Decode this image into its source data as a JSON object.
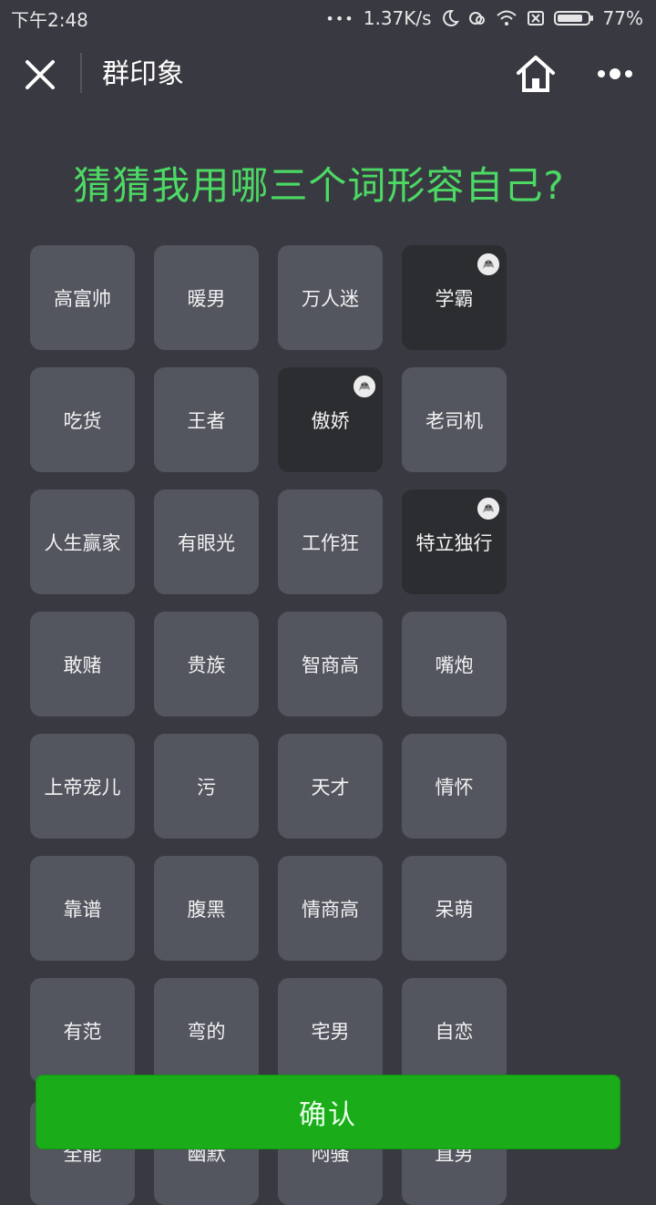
{
  "status_bar": {
    "time": "下午2:48",
    "dots": "•••",
    "speed": "1.37K/s",
    "battery": "77%",
    "icons": [
      "moon-icon",
      "sync-icon",
      "wifi-icon",
      "sim-off-icon",
      "battery-icon"
    ]
  },
  "nav": {
    "title": "群印象",
    "icons": [
      "close-icon",
      "home-icon",
      "more-icon"
    ]
  },
  "question": "猜猜我用哪三个词形容自己?",
  "colors": {
    "background": "#393a41",
    "tile": "#53555f",
    "tile_selected": "#2c2d31",
    "question": "#4cd964",
    "confirm": "#1aad19"
  },
  "tags": [
    {
      "label": "高富帅",
      "selected": false
    },
    {
      "label": "暖男",
      "selected": false
    },
    {
      "label": "万人迷",
      "selected": false
    },
    {
      "label": "学霸",
      "selected": true
    },
    {
      "label": "吃货",
      "selected": false
    },
    {
      "label": "王者",
      "selected": false
    },
    {
      "label": "傲娇",
      "selected": true
    },
    {
      "label": "老司机",
      "selected": false
    },
    {
      "label": "人生赢家",
      "selected": false
    },
    {
      "label": "有眼光",
      "selected": false
    },
    {
      "label": "工作狂",
      "selected": false
    },
    {
      "label": "特立独行",
      "selected": true
    },
    {
      "label": "敢赌",
      "selected": false
    },
    {
      "label": "贵族",
      "selected": false
    },
    {
      "label": "智商高",
      "selected": false
    },
    {
      "label": "嘴炮",
      "selected": false
    },
    {
      "label": "上帝宠儿",
      "selected": false
    },
    {
      "label": "污",
      "selected": false
    },
    {
      "label": "天才",
      "selected": false
    },
    {
      "label": "情怀",
      "selected": false
    },
    {
      "label": "靠谱",
      "selected": false
    },
    {
      "label": "腹黑",
      "selected": false
    },
    {
      "label": "情商高",
      "selected": false
    },
    {
      "label": "呆萌",
      "selected": false
    },
    {
      "label": "有范",
      "selected": false
    },
    {
      "label": "弯的",
      "selected": false
    },
    {
      "label": "宅男",
      "selected": false
    },
    {
      "label": "自恋",
      "selected": false
    },
    {
      "label": "全能",
      "selected": false
    },
    {
      "label": "幽默",
      "selected": false
    },
    {
      "label": "闷骚",
      "selected": false
    },
    {
      "label": "直男",
      "selected": false
    }
  ],
  "confirm_label": "确认"
}
